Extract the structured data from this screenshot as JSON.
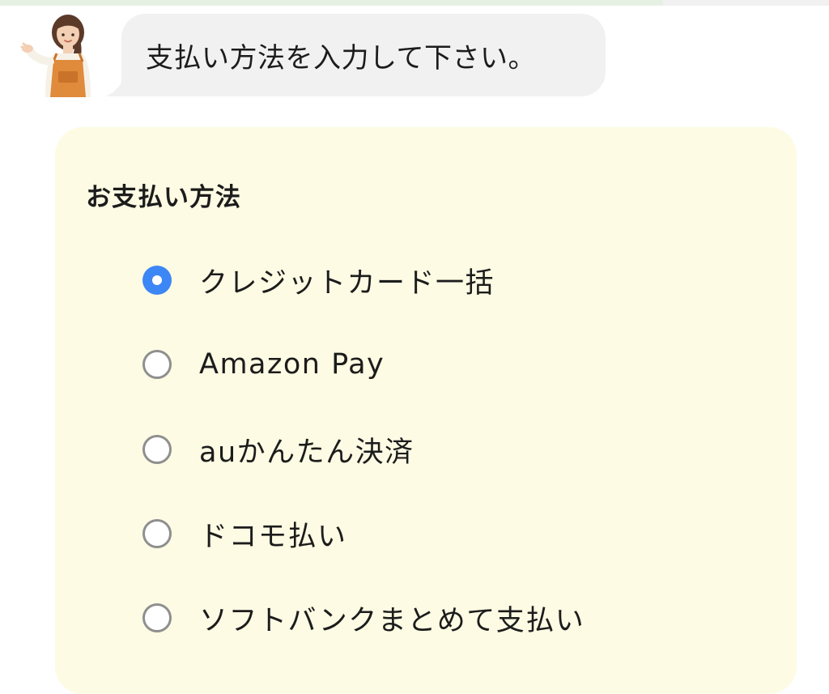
{
  "header": {
    "message": "支払い方法を入力して下さい。",
    "progress_fraction": 0.8
  },
  "payment": {
    "title": "お支払い方法",
    "options": [
      {
        "label": "クレジットカード一括",
        "selected": true
      },
      {
        "label": "Amazon Pay",
        "selected": false
      },
      {
        "label": "auかんたん決済",
        "selected": false
      },
      {
        "label": "ドコモ払い",
        "selected": false
      },
      {
        "label": "ソフトバンクまとめて支払い",
        "selected": false
      }
    ]
  },
  "colors": {
    "accent": "#3d86f5",
    "panel": "#fdfbe3",
    "bubble": "#f1f1f1",
    "apron": "#e08a3c"
  },
  "icons": {
    "avatar": "shop-staff-avatar-icon"
  }
}
